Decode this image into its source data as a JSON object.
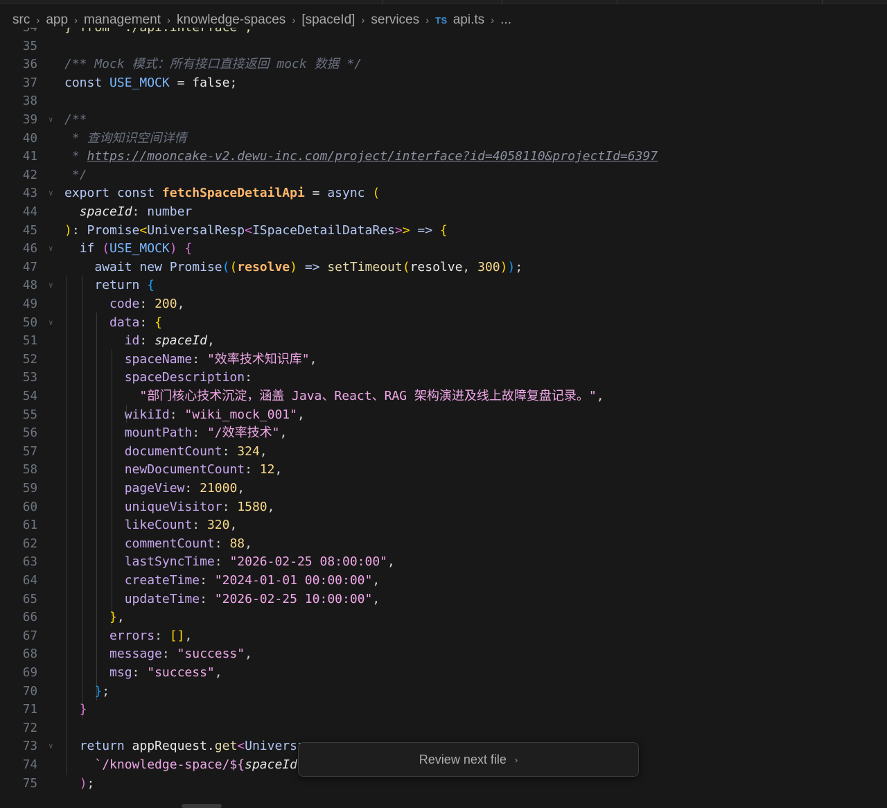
{
  "breadcrumb": {
    "items": [
      "src",
      "app",
      "management",
      "knowledge-spaces",
      "[spaceId]",
      "services"
    ],
    "file_badge": "TS",
    "file_name": "api.ts",
    "ellipsis": "..."
  },
  "review": {
    "label": "Review next file"
  },
  "colors": {
    "keyword": "#569cd6",
    "function_name": "#dcdcaa",
    "string": "#ce9178",
    "number": "#b5cea8",
    "property": "#9cdcfe",
    "comment": "#6a9955",
    "bracket_gold": "#ffd700",
    "bracket_purple": "#da70d6",
    "bracket_blue": "#179fff"
  },
  "editor": {
    "lines": [
      {
        "n": "34",
        "tokens": [
          [
            "} from './api.interface';",
            "#dcdcaa"
          ]
        ]
      },
      {
        "n": "35",
        "tokens": []
      },
      {
        "n": "36",
        "tokens": [
          [
            "/** Mock 模式：所有接口直接返回 mock 数据 */",
            "#6a7080",
            "italic"
          ]
        ]
      },
      {
        "n": "37",
        "tokens": [
          [
            "const ",
            "#b4c7f5"
          ],
          [
            "USE_MOCK",
            "#79b8ff"
          ],
          [
            " = ",
            "#d4d4d4"
          ],
          [
            "false",
            "#e8e8e8"
          ],
          [
            ";",
            "#d4d4d4"
          ]
        ]
      },
      {
        "n": "38",
        "tokens": []
      },
      {
        "n": "39",
        "fold": true,
        "tokens": [
          [
            "/**",
            "#6a7080",
            "italic"
          ]
        ]
      },
      {
        "n": "40",
        "tokens": [
          [
            " * 查询知识空间详情",
            "#6a7080",
            "italic"
          ]
        ]
      },
      {
        "n": "41",
        "tokens": [
          [
            " * ",
            "#6a7080",
            "italic"
          ],
          [
            "https://mooncake-v2.dewu-inc.com/project/interface?id=4058110&projectId=6397",
            "#8a8fa0",
            "italic-underline"
          ]
        ]
      },
      {
        "n": "42",
        "tokens": [
          [
            " */",
            "#6a7080",
            "italic"
          ]
        ]
      },
      {
        "n": "43",
        "fold": true,
        "tokens": [
          [
            "export const ",
            "#b4c7f5"
          ],
          [
            "fetchSpaceDetailApi",
            "#ffb86c",
            "bold"
          ],
          [
            " = ",
            "#d4d4d4"
          ],
          [
            "async ",
            "#b4c7f5"
          ],
          [
            "(",
            "#ffd700"
          ]
        ]
      },
      {
        "n": "44",
        "tokens": [
          [
            "  ",
            "#d4d4d4"
          ],
          [
            "spaceId",
            "#e8e8e8",
            "italic"
          ],
          [
            ": ",
            "#d4d4d4"
          ],
          [
            "number",
            "#b4c7f5"
          ]
        ]
      },
      {
        "n": "45",
        "tokens": [
          [
            ")",
            "#ffd700"
          ],
          [
            ": ",
            "#d4d4d4"
          ],
          [
            "Promise",
            "#b4c7f5"
          ],
          [
            "<",
            "#ffd700"
          ],
          [
            "UniversalResp",
            "#b4c7f5"
          ],
          [
            "<",
            "#da70d6"
          ],
          [
            "ISpaceDetailDataRes",
            "#b4c7f5"
          ],
          [
            ">",
            "#da70d6"
          ],
          [
            ">",
            "#ffd700"
          ],
          [
            " => ",
            "#b4c7f5"
          ],
          [
            "{",
            "#ffd700"
          ]
        ]
      },
      {
        "n": "46",
        "fold": true,
        "tokens": [
          [
            "  ",
            "#d4d4d4"
          ],
          [
            "if ",
            "#b4c7f5"
          ],
          [
            "(",
            "#da70d6"
          ],
          [
            "USE_MOCK",
            "#79b8ff"
          ],
          [
            ")",
            "#da70d6"
          ],
          [
            " {",
            "#da70d6"
          ]
        ]
      },
      {
        "n": "47",
        "tokens": [
          [
            "    ",
            "#d4d4d4"
          ],
          [
            "await new ",
            "#b4c7f5"
          ],
          [
            "Promise",
            "#b4c7f5"
          ],
          [
            "(",
            "#179fff"
          ],
          [
            "(",
            "#ffd700"
          ],
          [
            "resolve",
            "#ffb86c",
            "bold"
          ],
          [
            ")",
            "#ffd700"
          ],
          [
            " => ",
            "#b4c7f5"
          ],
          [
            "setTimeout",
            "#e8dcaa"
          ],
          [
            "(",
            "#ffd700"
          ],
          [
            "resolve",
            "#e8e8e8"
          ],
          [
            ", ",
            "#d4d4d4"
          ],
          [
            "300",
            "#f8d88a"
          ],
          [
            ")",
            "#ffd700"
          ],
          [
            ")",
            "#179fff"
          ],
          [
            ";",
            "#d4d4d4"
          ]
        ]
      },
      {
        "n": "48",
        "fold": true,
        "tokens": [
          [
            "    ",
            "#d4d4d4"
          ],
          [
            "return ",
            "#b4c7f5"
          ],
          [
            "{",
            "#179fff"
          ]
        ]
      },
      {
        "n": "49",
        "tokens": [
          [
            "      ",
            "#d4d4d4"
          ],
          [
            "code",
            "#c8a8f0"
          ],
          [
            ": ",
            "#d4d4d4"
          ],
          [
            "200",
            "#f8d88a"
          ],
          [
            ",",
            "#d4d4d4"
          ]
        ]
      },
      {
        "n": "50",
        "fold": true,
        "tokens": [
          [
            "      ",
            "#d4d4d4"
          ],
          [
            "data",
            "#c8a8f0"
          ],
          [
            ": ",
            "#d4d4d4"
          ],
          [
            "{",
            "#ffd700"
          ]
        ]
      },
      {
        "n": "51",
        "tokens": [
          [
            "        ",
            "#d4d4d4"
          ],
          [
            "id",
            "#c8a8f0"
          ],
          [
            ": ",
            "#d4d4d4"
          ],
          [
            "spaceId",
            "#e8e8e8",
            "italic"
          ],
          [
            ",",
            "#d4d4d4"
          ]
        ]
      },
      {
        "n": "52",
        "tokens": [
          [
            "        ",
            "#d4d4d4"
          ],
          [
            "spaceName",
            "#c8a8f0"
          ],
          [
            ": ",
            "#d4d4d4"
          ],
          [
            "\"效率技术知识库\"",
            "#f0a8e8"
          ],
          [
            ",",
            "#d4d4d4"
          ]
        ]
      },
      {
        "n": "53",
        "tokens": [
          [
            "        ",
            "#d4d4d4"
          ],
          [
            "spaceDescription",
            "#c8a8f0"
          ],
          [
            ":",
            "#d4d4d4"
          ]
        ]
      },
      {
        "n": "54",
        "tokens": [
          [
            "          ",
            "#d4d4d4"
          ],
          [
            "\"部门核心技术沉淀，涵盖 Java、React、RAG 架构演进及线上故障复盘记录。\"",
            "#f0a8e8"
          ],
          [
            ",",
            "#d4d4d4"
          ]
        ]
      },
      {
        "n": "55",
        "tokens": [
          [
            "        ",
            "#d4d4d4"
          ],
          [
            "wikiId",
            "#c8a8f0"
          ],
          [
            ": ",
            "#d4d4d4"
          ],
          [
            "\"wiki_mock_001\"",
            "#f0a8e8"
          ],
          [
            ",",
            "#d4d4d4"
          ]
        ]
      },
      {
        "n": "56",
        "tokens": [
          [
            "        ",
            "#d4d4d4"
          ],
          [
            "mountPath",
            "#c8a8f0"
          ],
          [
            ": ",
            "#d4d4d4"
          ],
          [
            "\"/效率技术\"",
            "#f0a8e8"
          ],
          [
            ",",
            "#d4d4d4"
          ]
        ]
      },
      {
        "n": "57",
        "tokens": [
          [
            "        ",
            "#d4d4d4"
          ],
          [
            "documentCount",
            "#c8a8f0"
          ],
          [
            ": ",
            "#d4d4d4"
          ],
          [
            "324",
            "#f8d88a"
          ],
          [
            ",",
            "#d4d4d4"
          ]
        ]
      },
      {
        "n": "58",
        "tokens": [
          [
            "        ",
            "#d4d4d4"
          ],
          [
            "newDocumentCount",
            "#c8a8f0"
          ],
          [
            ": ",
            "#d4d4d4"
          ],
          [
            "12",
            "#f8d88a"
          ],
          [
            ",",
            "#d4d4d4"
          ]
        ]
      },
      {
        "n": "59",
        "tokens": [
          [
            "        ",
            "#d4d4d4"
          ],
          [
            "pageView",
            "#c8a8f0"
          ],
          [
            ": ",
            "#d4d4d4"
          ],
          [
            "21000",
            "#f8d88a"
          ],
          [
            ",",
            "#d4d4d4"
          ]
        ]
      },
      {
        "n": "60",
        "tokens": [
          [
            "        ",
            "#d4d4d4"
          ],
          [
            "uniqueVisitor",
            "#c8a8f0"
          ],
          [
            ": ",
            "#d4d4d4"
          ],
          [
            "1580",
            "#f8d88a"
          ],
          [
            ",",
            "#d4d4d4"
          ]
        ]
      },
      {
        "n": "61",
        "tokens": [
          [
            "        ",
            "#d4d4d4"
          ],
          [
            "likeCount",
            "#c8a8f0"
          ],
          [
            ": ",
            "#d4d4d4"
          ],
          [
            "320",
            "#f8d88a"
          ],
          [
            ",",
            "#d4d4d4"
          ]
        ]
      },
      {
        "n": "62",
        "tokens": [
          [
            "        ",
            "#d4d4d4"
          ],
          [
            "commentCount",
            "#c8a8f0"
          ],
          [
            ": ",
            "#d4d4d4"
          ],
          [
            "88",
            "#f8d88a"
          ],
          [
            ",",
            "#d4d4d4"
          ]
        ]
      },
      {
        "n": "63",
        "tokens": [
          [
            "        ",
            "#d4d4d4"
          ],
          [
            "lastSyncTime",
            "#c8a8f0"
          ],
          [
            ": ",
            "#d4d4d4"
          ],
          [
            "\"2026-02-25 08:00:00\"",
            "#f0a8e8"
          ],
          [
            ",",
            "#d4d4d4"
          ]
        ]
      },
      {
        "n": "64",
        "tokens": [
          [
            "        ",
            "#d4d4d4"
          ],
          [
            "createTime",
            "#c8a8f0"
          ],
          [
            ": ",
            "#d4d4d4"
          ],
          [
            "\"2024-01-01 00:00:00\"",
            "#f0a8e8"
          ],
          [
            ",",
            "#d4d4d4"
          ]
        ]
      },
      {
        "n": "65",
        "tokens": [
          [
            "        ",
            "#d4d4d4"
          ],
          [
            "updateTime",
            "#c8a8f0"
          ],
          [
            ": ",
            "#d4d4d4"
          ],
          [
            "\"2026-02-25 10:00:00\"",
            "#f0a8e8"
          ],
          [
            ",",
            "#d4d4d4"
          ]
        ]
      },
      {
        "n": "66",
        "tokens": [
          [
            "      ",
            "#d4d4d4"
          ],
          [
            "}",
            "#ffd700"
          ],
          [
            ",",
            "#d4d4d4"
          ]
        ]
      },
      {
        "n": "67",
        "tokens": [
          [
            "      ",
            "#d4d4d4"
          ],
          [
            "errors",
            "#c8a8f0"
          ],
          [
            ": ",
            "#d4d4d4"
          ],
          [
            "[]",
            "#ffd700"
          ],
          [
            ",",
            "#d4d4d4"
          ]
        ]
      },
      {
        "n": "68",
        "tokens": [
          [
            "      ",
            "#d4d4d4"
          ],
          [
            "message",
            "#c8a8f0"
          ],
          [
            ": ",
            "#d4d4d4"
          ],
          [
            "\"success\"",
            "#f0a8e8"
          ],
          [
            ",",
            "#d4d4d4"
          ]
        ]
      },
      {
        "n": "69",
        "tokens": [
          [
            "      ",
            "#d4d4d4"
          ],
          [
            "msg",
            "#c8a8f0"
          ],
          [
            ": ",
            "#d4d4d4"
          ],
          [
            "\"success\"",
            "#f0a8e8"
          ],
          [
            ",",
            "#d4d4d4"
          ]
        ]
      },
      {
        "n": "70",
        "tokens": [
          [
            "    ",
            "#d4d4d4"
          ],
          [
            "}",
            "#179fff"
          ],
          [
            ";",
            "#d4d4d4"
          ]
        ]
      },
      {
        "n": "71",
        "tokens": [
          [
            "  ",
            "#d4d4d4"
          ],
          [
            "}",
            "#da70d6"
          ]
        ]
      },
      {
        "n": "72",
        "tokens": []
      },
      {
        "n": "73",
        "fold": true,
        "tokens": [
          [
            "  ",
            "#d4d4d4"
          ],
          [
            "return ",
            "#b4c7f5"
          ],
          [
            "appRequest",
            "#e8e8e8"
          ],
          [
            ".",
            "#d4d4d4"
          ],
          [
            "get",
            "#e8dcaa"
          ],
          [
            "<",
            "#da70d6"
          ],
          [
            "Universa",
            "#b4c7f5"
          ]
        ]
      },
      {
        "n": "74",
        "tokens": [
          [
            "    ",
            "#d4d4d4"
          ],
          [
            "`/knowledge-space/${",
            "#f0a8e8"
          ],
          [
            "spaceId",
            "#e8e8e8",
            "italic"
          ],
          [
            "}",
            "#f0a8e8"
          ]
        ]
      },
      {
        "n": "75",
        "tokens": [
          [
            "  ",
            "#d4d4d4"
          ],
          [
            ")",
            "#da70d6"
          ],
          [
            ";",
            "#d4d4d4"
          ]
        ]
      }
    ]
  }
}
